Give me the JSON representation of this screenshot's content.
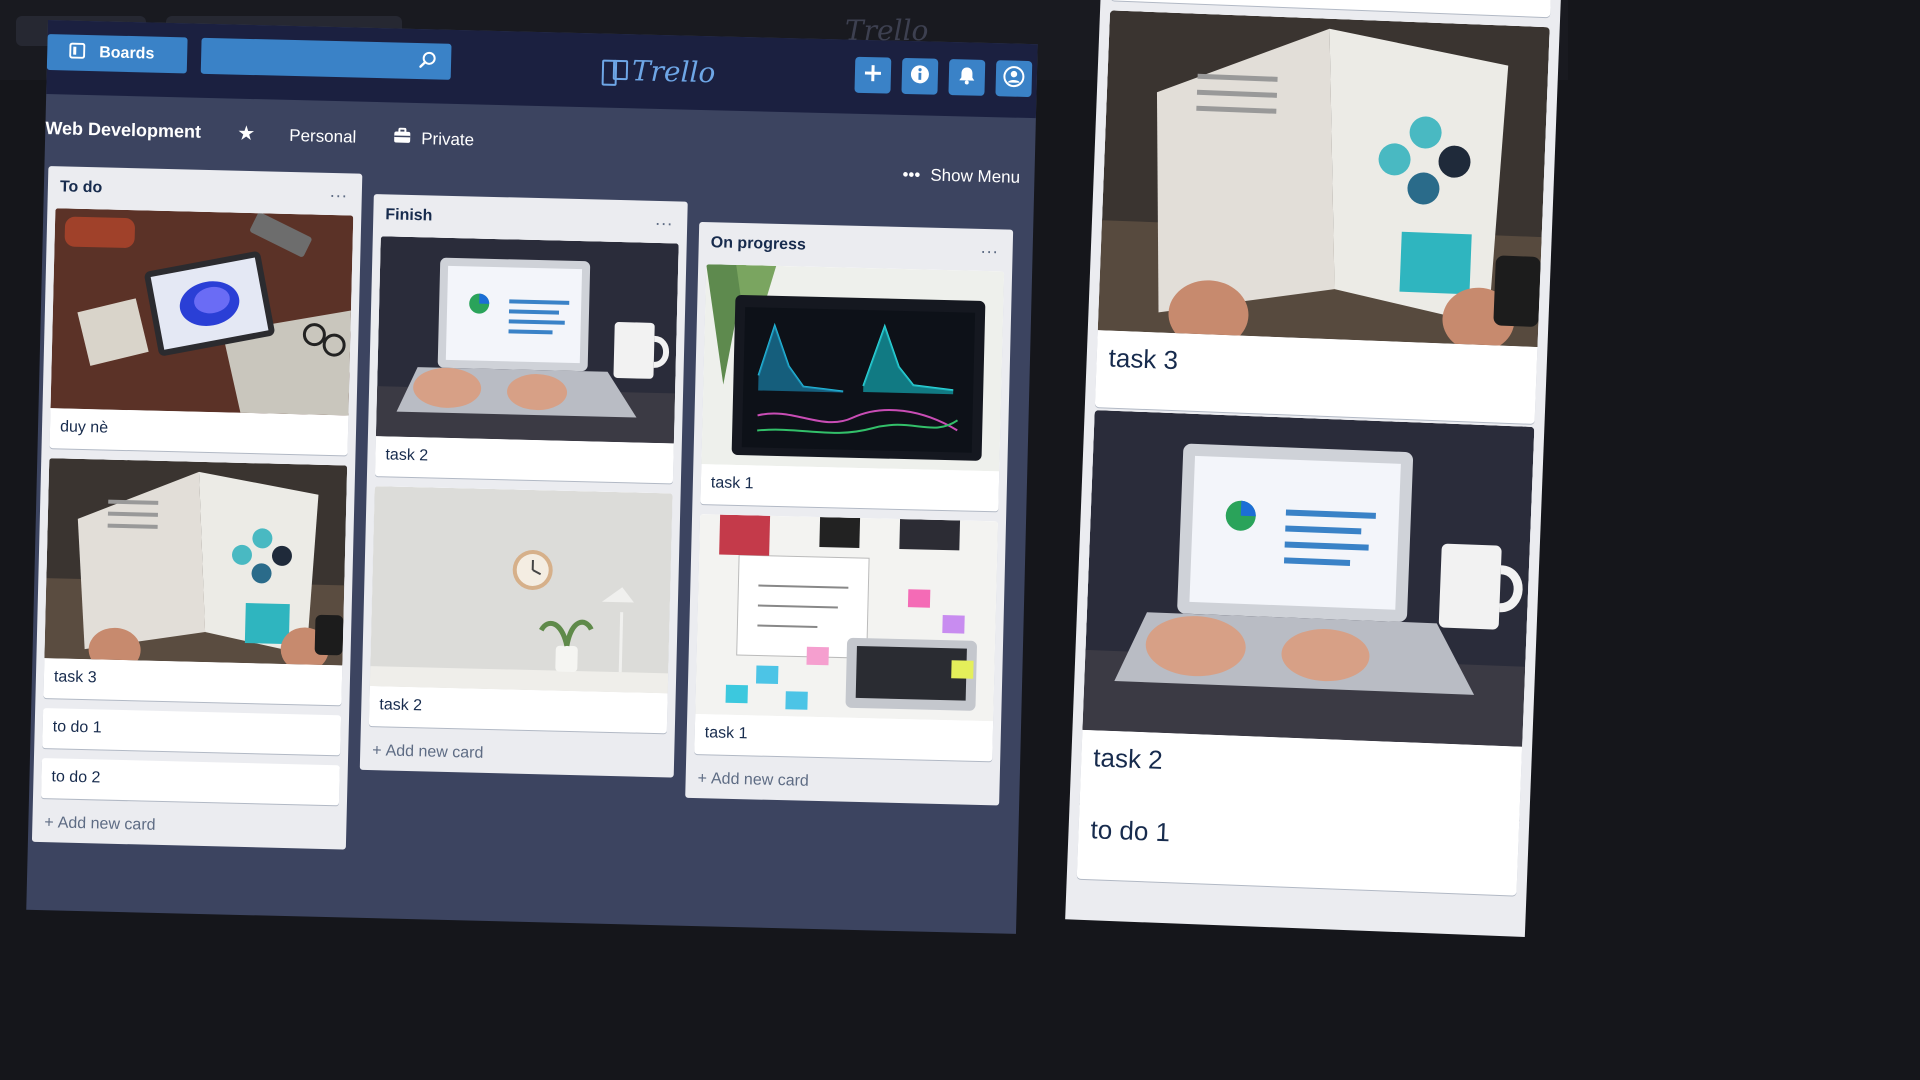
{
  "topbar": {
    "boards_label": "Boards",
    "search_placeholder": "",
    "logo_text": "Trello",
    "actions": [
      "plus-icon",
      "info-icon",
      "bell-icon",
      "user-icon"
    ]
  },
  "board": {
    "title": "Web Development",
    "visibility_team": "Personal",
    "visibility": "Private",
    "show_menu": "Show Menu"
  },
  "lists": [
    {
      "title": "To do",
      "more": "...",
      "cards": [
        {
          "title": "duy nè",
          "cover": "tablet-on-desk-photo"
        },
        {
          "title": "task 3",
          "cover": "open-magazine-photo"
        },
        {
          "title": "to do 1"
        },
        {
          "title": "to do 2"
        }
      ],
      "add_label": "Add new card"
    },
    {
      "title": "Finish",
      "more": "...",
      "cards": [
        {
          "title": "task 2",
          "cover": "laptop-analytics-photo"
        },
        {
          "title": "task 2",
          "cover": "wall-clock-desk-photo"
        }
      ],
      "add_label": "Add new card"
    },
    {
      "title": "On progress",
      "more": "...",
      "cards": [
        {
          "title": "task 1",
          "cover": "dashboard-monitor-photo"
        },
        {
          "title": "task 1",
          "cover": "sticky-notes-planning-photo"
        }
      ],
      "add_label": "Add new card"
    }
  ],
  "zoom_panel": {
    "cards": [
      {
        "title": "task 3",
        "cover": "open-magazine-photo"
      },
      {
        "title": "task 2",
        "cover": "laptop-analytics-photo"
      },
      {
        "title": "to do 1"
      }
    ]
  },
  "colors": {
    "topbar_bg": "#1b2040",
    "board_bg": "#3c4460",
    "button_blue": "#3a82c7",
    "list_bg": "#ebecf0",
    "logo_blue": "#6ea6e6"
  }
}
